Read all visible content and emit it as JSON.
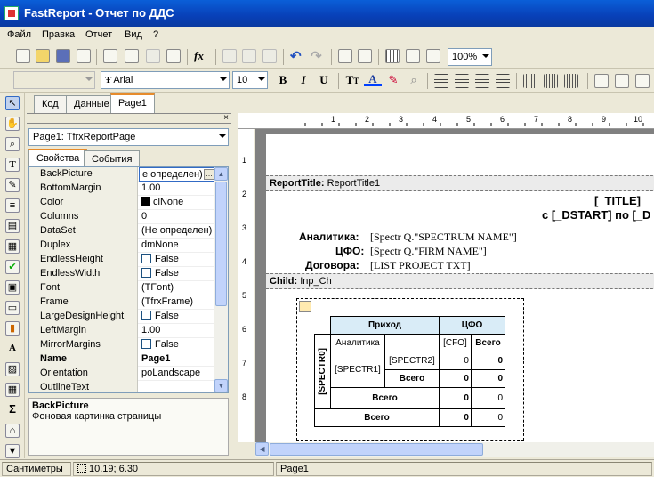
{
  "window": {
    "title": "FastReport - Отчет по ДДС",
    "minimize": "_",
    "maximize": "□",
    "close": "×"
  },
  "menu": [
    "Файл",
    "Правка",
    "Отчет",
    "Вид",
    "?"
  ],
  "toolbar": {
    "zoom": "100%",
    "font_name": "Arial",
    "font_size": "10",
    "bold": "B",
    "italic": "I",
    "underline": "U",
    "style_combo": ""
  },
  "tabs": {
    "code": "Код",
    "data": "Данные",
    "page": "Page1"
  },
  "inspector": {
    "object": "Page1: TfrxReportPage",
    "tab_props": "Свойства",
    "tab_events": "События",
    "rows": [
      {
        "name": "BackPicture",
        "value": "е определен)"
      },
      {
        "name": "BottomMargin",
        "value": "1.00"
      },
      {
        "name": "Color",
        "value": "clNone"
      },
      {
        "name": "Columns",
        "value": "0"
      },
      {
        "name": "DataSet",
        "value": "(Не определен)"
      },
      {
        "name": "Duplex",
        "value": "dmNone"
      },
      {
        "name": "EndlessHeight",
        "value": "False"
      },
      {
        "name": "EndlessWidth",
        "value": "False"
      },
      {
        "name": "Font",
        "value": "(TFont)"
      },
      {
        "name": "Frame",
        "value": "(TfrxFrame)"
      },
      {
        "name": "LargeDesignHeight",
        "value": "False"
      },
      {
        "name": "LeftMargin",
        "value": "1.00"
      },
      {
        "name": "MirrorMargins",
        "value": "False"
      },
      {
        "name": "Name",
        "value": "Page1"
      },
      {
        "name": "Orientation",
        "value": "poLandscape"
      },
      {
        "name": "OutlineText",
        "value": ""
      }
    ],
    "desc_title": "BackPicture",
    "desc_text": "Фоновая картинка страницы"
  },
  "ruler": {
    "h": [
      "1",
      "2",
      "3",
      "4",
      "5",
      "6",
      "7",
      "8",
      "9",
      "10"
    ],
    "v": [
      "1",
      "2",
      "3",
      "4",
      "5",
      "6",
      "7",
      "8"
    ]
  },
  "report": {
    "title_band": "ReportTitle:",
    "title_band_name": "ReportTitle1",
    "title_field": "[_TITLE]",
    "date_line": "с [_DSTART] по [_D",
    "label_analytics": "Аналитика:",
    "value_analytics": "[Spectr Q.\"SPECTRUM NAME\"]",
    "label_cfo": "ЦФО:",
    "value_cfo": "[Spectr Q.\"FIRM NAME\"]",
    "label_contracts": "Договора:",
    "value_contracts": "[LIST PROJECT TXT]",
    "child_band": "Child:",
    "child_band_name": "Inp_Ch",
    "cross": {
      "income": "Приход",
      "cfo": "ЦФО",
      "analytics": "Аналитика",
      "cfo_field": "[CFO]",
      "total": "Всего",
      "spectr0": "[SPECTR0]",
      "spectr1": "[SPECTR1]",
      "spectr2": "[SPECTR2]",
      "zero": "0"
    }
  },
  "status": {
    "units": "Сантиметры",
    "coords": "10.19; 6.30",
    "page": "Page1"
  }
}
